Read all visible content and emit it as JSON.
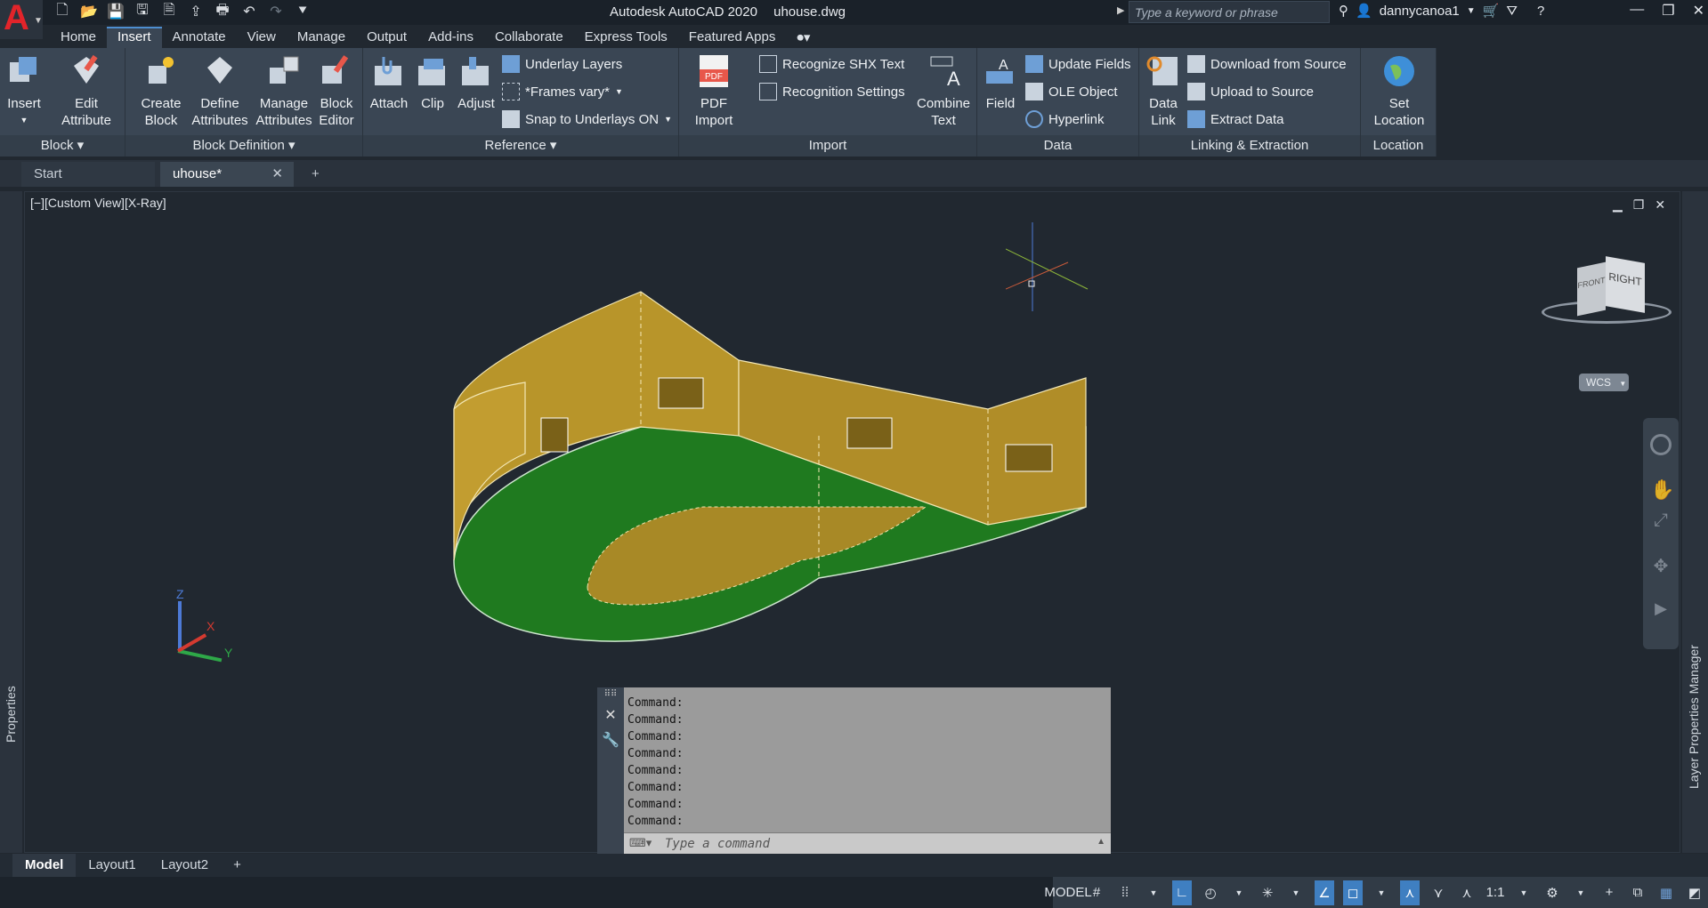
{
  "app": {
    "title": "Autodesk AutoCAD 2020",
    "filename": "uhouse.dwg",
    "search_placeholder": "Type a keyword or phrase",
    "username": "dannycanoa1",
    "logo_letter": "A"
  },
  "menu_tabs": [
    "Home",
    "Insert",
    "Annotate",
    "View",
    "Manage",
    "Output",
    "Add-ins",
    "Collaborate",
    "Express Tools",
    "Featured Apps"
  ],
  "active_menu_tab": "Insert",
  "ribbon": {
    "block": {
      "label": "Block",
      "insert": "Insert",
      "edit_attribute_1": "Edit",
      "edit_attribute_2": "Attribute"
    },
    "block_definition": {
      "label": "Block Definition",
      "create_block_1": "Create",
      "create_block_2": "Block",
      "define_attributes_1": "Define",
      "define_attributes_2": "Attributes",
      "manage_attributes_1": "Manage",
      "manage_attributes_2": "Attributes",
      "block_editor_1": "Block",
      "block_editor_2": "Editor"
    },
    "reference": {
      "label": "Reference",
      "attach": "Attach",
      "clip": "Clip",
      "adjust": "Adjust",
      "underlay_layers": "Underlay Layers",
      "frames_vary": "*Frames vary*",
      "snap_to_underlays": "Snap to Underlays ON"
    },
    "import": {
      "label": "Import",
      "pdf_import_1": "PDF",
      "pdf_import_2": "Import",
      "pdf_icon_text": "PDF",
      "recognize_shx": "Recognize SHX Text",
      "recognition_settings": "Recognition Settings",
      "combine_text_1": "Combine",
      "combine_text_2": "Text"
    },
    "data": {
      "label": "Data",
      "field": "Field",
      "update_fields": "Update Fields",
      "ole_object": "OLE Object",
      "hyperlink": "Hyperlink"
    },
    "linking": {
      "label": "Linking & Extraction",
      "data_link_1": "Data",
      "data_link_2": "Link",
      "download_from_source": "Download from Source",
      "upload_to_source": "Upload to Source",
      "extract_data": "Extract  Data"
    },
    "location": {
      "label": "Location",
      "set_location_1": "Set",
      "set_location_2": "Location"
    }
  },
  "file_tabs": {
    "start": "Start",
    "current": "uhouse*"
  },
  "viewport": {
    "label": "[−][Custom View][X-Ray]",
    "viewcube_front": "FRONT",
    "viewcube_right": "RIGHT",
    "wcs": "WCS",
    "ucs_z": "Z",
    "ucs_x": "X",
    "ucs_y": "Y"
  },
  "palettes": {
    "left": "Properties",
    "right": "Layer Properties Manager"
  },
  "command": {
    "history": [
      "Command:",
      "Command:",
      "Command:",
      "Command:",
      "Command:",
      "Command:",
      "Command:",
      "Command:"
    ],
    "placeholder": "Type a command"
  },
  "layout_tabs": [
    "Model",
    "Layout1",
    "Layout2"
  ],
  "status": {
    "model": "MODEL",
    "scale": "1:1"
  },
  "colors": {
    "wall": "#b8952a",
    "floor": "#1f7a1f",
    "accent": "#3f7fc1",
    "logo": "#e2242a"
  }
}
